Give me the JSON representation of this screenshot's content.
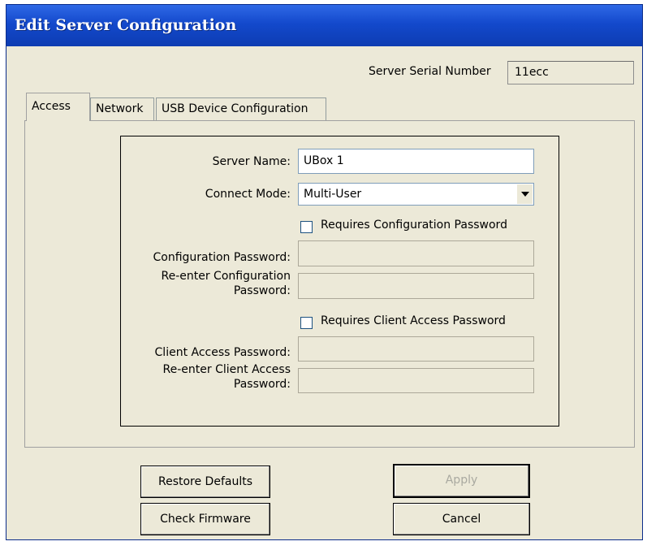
{
  "window": {
    "title": "Edit Server Configuration"
  },
  "serial": {
    "label": "Server Serial Number",
    "value": "11ecc"
  },
  "tabs": [
    {
      "label": "Access",
      "active": true
    },
    {
      "label": "Network",
      "active": false
    },
    {
      "label": "USB Device Configuration",
      "active": false
    }
  ],
  "access": {
    "server_name_label": "Server Name:",
    "server_name_value": "UBox 1",
    "connect_mode_label": "Connect Mode:",
    "connect_mode_value": "Multi-User",
    "requires_config_password_label": "Requires Configuration Password",
    "requires_config_password_checked": false,
    "config_password_label": "Configuration Password:",
    "reenter_config_password_label": "Re-enter Configuration Password:",
    "requires_client_password_label": "Requires Client Access Password",
    "requires_client_password_checked": false,
    "client_password_label": "Client Access Password:",
    "reenter_client_password_label": "Re-enter Client Access Password:"
  },
  "buttons": {
    "restore_defaults": "Restore Defaults",
    "check_firmware": "Check Firmware",
    "apply": "Apply",
    "cancel": "Cancel"
  },
  "colors": {
    "titlebar": "#1349cc",
    "window_bg": "#ece9d8"
  }
}
